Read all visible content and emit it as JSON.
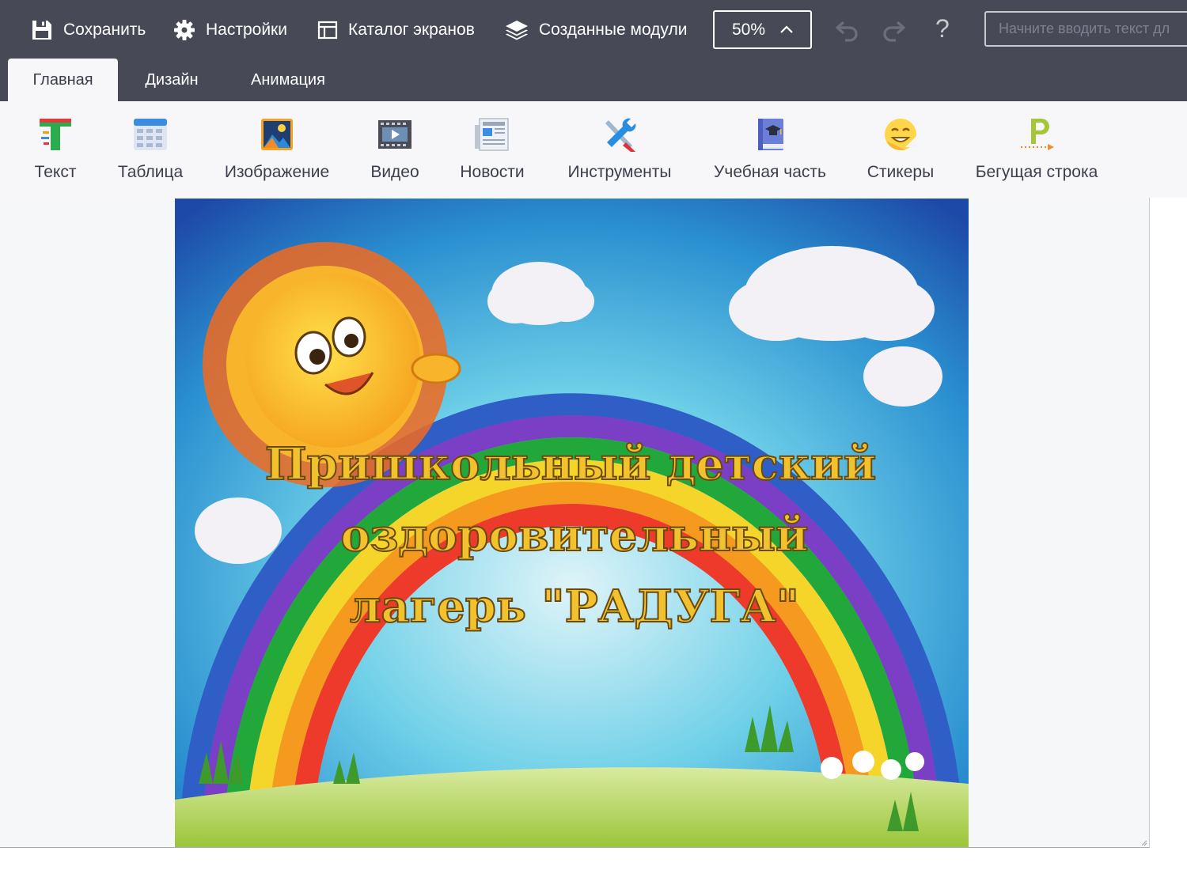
{
  "toolbar": {
    "save_label": "Сохранить",
    "settings_label": "Настройки",
    "catalog_label": "Каталог экранов",
    "modules_label": "Созданные модули",
    "zoom_value": "50%",
    "help_label": "?",
    "search_placeholder": "Начните вводить текст дл"
  },
  "tabs": [
    {
      "label": "Главная",
      "active": true
    },
    {
      "label": "Дизайн",
      "active": false
    },
    {
      "label": "Анимация",
      "active": false
    }
  ],
  "ribbon": [
    {
      "label": "Текст",
      "icon": "text-icon"
    },
    {
      "label": "Таблица",
      "icon": "table-icon"
    },
    {
      "label": "Изображение",
      "icon": "image-icon"
    },
    {
      "label": "Видео",
      "icon": "video-icon"
    },
    {
      "label": "Новости",
      "icon": "news-icon"
    },
    {
      "label": "Инструменты",
      "icon": "tools-icon"
    },
    {
      "label": "Учебная часть",
      "icon": "study-icon"
    },
    {
      "label": "Стикеры",
      "icon": "sticker-icon"
    },
    {
      "label": "Бегущая строка",
      "icon": "ticker-icon"
    }
  ],
  "slide": {
    "lines": [
      "Пришкольный детский",
      "оздоровительный",
      "лагерь \"РАДУГА\""
    ]
  },
  "colors": {
    "topbar": "#474a56",
    "ribbon": "#f7f7f9",
    "slide_title": "#f2c12e"
  }
}
